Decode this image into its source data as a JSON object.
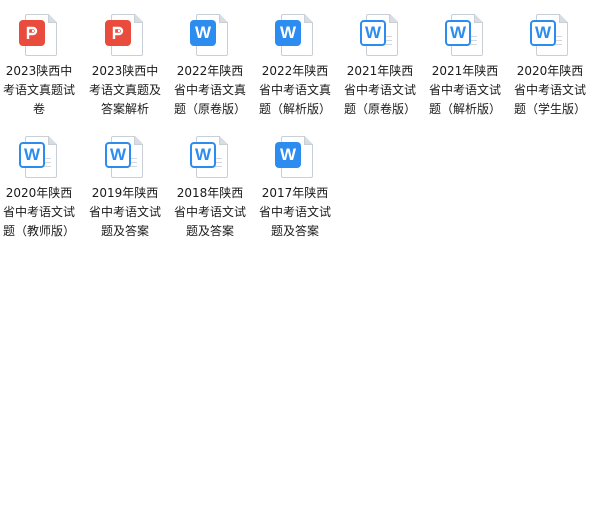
{
  "files": [
    {
      "name": "2023陕西中考语文真题试卷",
      "type": "pdf",
      "icon": "pdf-file-icon"
    },
    {
      "name": "2023陕西中考语文真题及答案解析",
      "type": "pdf",
      "icon": "pdf-file-icon"
    },
    {
      "name": "2022年陕西省中考语文真题（原卷版）",
      "type": "wps",
      "icon": "word-file-icon"
    },
    {
      "name": "2022年陕西省中考语文真题（解析版）",
      "type": "wps",
      "icon": "word-file-icon"
    },
    {
      "name": "2021年陕西省中考语文试题（原卷版）",
      "type": "wps-outline",
      "icon": "word-file-icon"
    },
    {
      "name": "2021年陕西省中考语文试题（解析版）",
      "type": "wps-outline",
      "icon": "word-file-icon"
    },
    {
      "name": "2020年陕西省中考语文试题（学生版）",
      "type": "wps-outline",
      "icon": "word-file-icon"
    },
    {
      "name": "2020年陕西省中考语文试题（教师版）",
      "type": "wps-outline",
      "icon": "word-file-icon"
    },
    {
      "name": "2019年陕西省中考语文试题及答案",
      "type": "wps-outline",
      "icon": "word-file-icon"
    },
    {
      "name": "2018年陕西省中考语文试题及答案",
      "type": "wps-outline",
      "icon": "word-file-icon"
    },
    {
      "name": "2017年陕西省中考语文试题及答案",
      "type": "wps",
      "icon": "word-file-icon"
    }
  ],
  "colors": {
    "pdf": "#e94b3c",
    "wps": "#2d8cf0",
    "text": "#1a1a1a"
  }
}
